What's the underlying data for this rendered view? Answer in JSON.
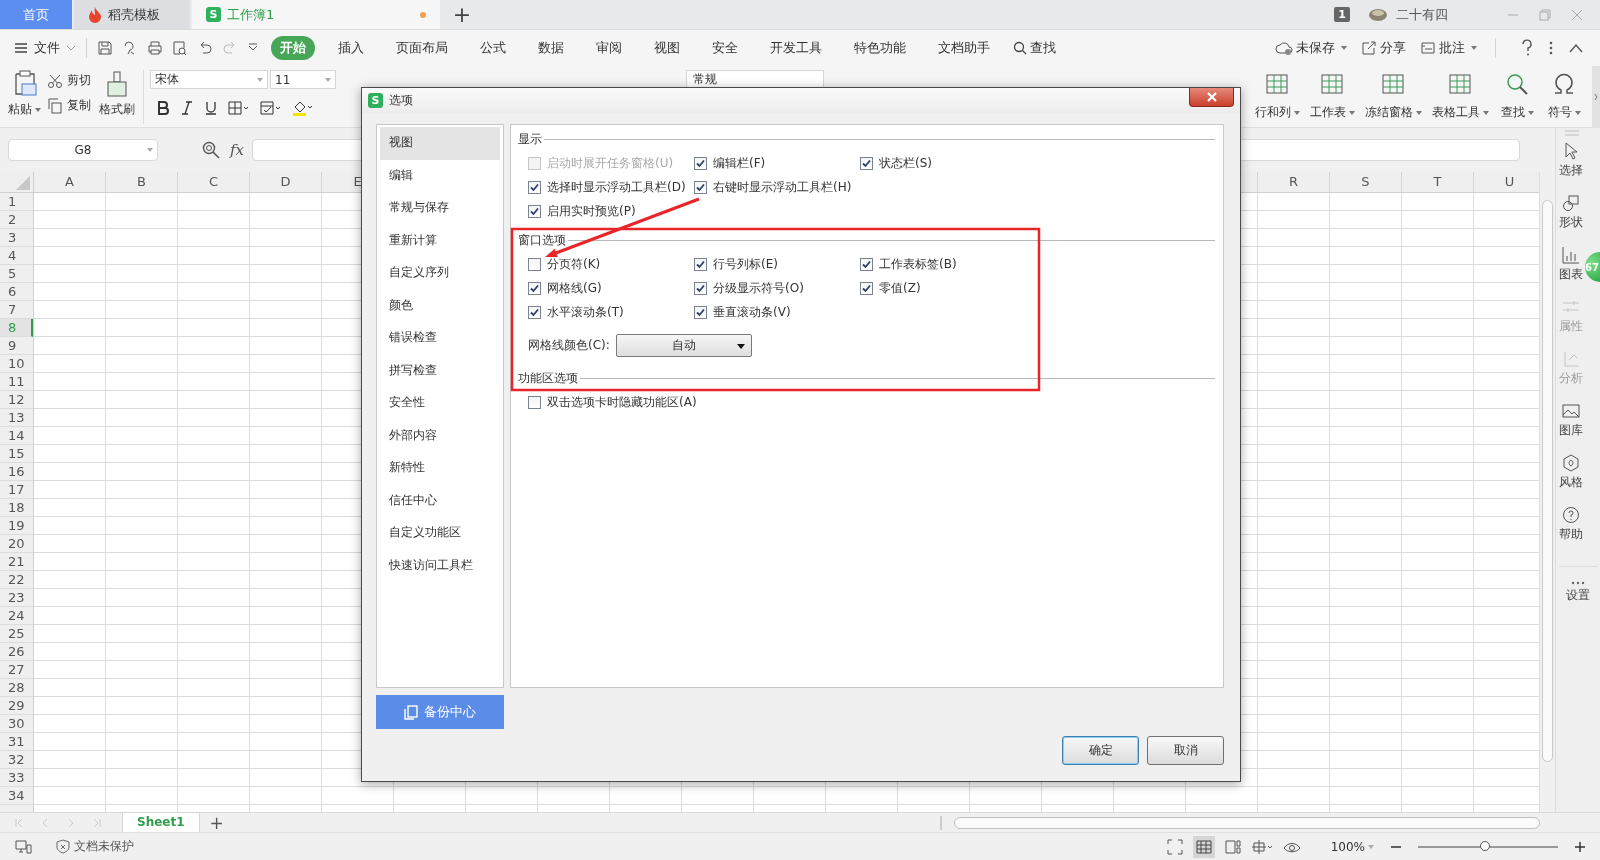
{
  "tabs": [
    {
      "label": "首页",
      "kind": "home",
      "selected": false
    },
    {
      "label": "稻壳模板",
      "kind": "docer",
      "selected": false
    },
    {
      "label": "工作簿1",
      "kind": "sheet",
      "logo": "S",
      "selected": true,
      "modified": true
    }
  ],
  "new_tab": "+",
  "account": {
    "badge": "1",
    "user": "二十有四"
  },
  "menu": {
    "file": "文件",
    "tabs": [
      {
        "label": "开始",
        "selected": true
      },
      {
        "label": "插入",
        "selected": false
      },
      {
        "label": "页面布局",
        "selected": false
      },
      {
        "label": "公式",
        "selected": false
      },
      {
        "label": "数据",
        "selected": false
      },
      {
        "label": "审阅",
        "selected": false
      },
      {
        "label": "视图",
        "selected": false
      },
      {
        "label": "安全",
        "selected": false
      },
      {
        "label": "开发工具",
        "selected": false
      },
      {
        "label": "特色功能",
        "selected": false
      },
      {
        "label": "文档助手",
        "selected": false
      }
    ],
    "search": "查找",
    "actions": [
      "未保存",
      "分享",
      "批注"
    ]
  },
  "ribbon": {
    "paste": "粘贴",
    "cut": "剪切",
    "copy": "复制",
    "format_painter": "格式刷",
    "font": "宋体",
    "size": "11",
    "number_format": "常规",
    "tools": [
      "行和列",
      "工作表",
      "冻结窗格",
      "表格工具",
      "查找",
      "符号"
    ]
  },
  "formula_bar": {
    "name_box": "G8",
    "fx": "fx"
  },
  "sheet": {
    "columns_left": [
      "A",
      "B",
      "C",
      "D",
      "E"
    ],
    "columns_right": [
      "R",
      "S",
      "T",
      "U"
    ],
    "rows": [
      {
        "label": "1",
        "selected": false
      },
      {
        "label": "2",
        "selected": false
      },
      {
        "label": "3",
        "selected": false
      },
      {
        "label": "4",
        "selected": false
      },
      {
        "label": "5",
        "selected": false
      },
      {
        "label": "6",
        "selected": false
      },
      {
        "label": "7",
        "selected": false
      },
      {
        "label": "8",
        "selected": true
      },
      {
        "label": "9",
        "selected": false
      },
      {
        "label": "10",
        "selected": false
      },
      {
        "label": "11",
        "selected": false
      },
      {
        "label": "12",
        "selected": false
      },
      {
        "label": "13",
        "selected": false
      },
      {
        "label": "14",
        "selected": false
      },
      {
        "label": "15",
        "selected": false
      },
      {
        "label": "16",
        "selected": false
      },
      {
        "label": "17",
        "selected": false
      },
      {
        "label": "18",
        "selected": false
      },
      {
        "label": "19",
        "selected": false
      },
      {
        "label": "20",
        "selected": false
      },
      {
        "label": "21",
        "selected": false
      },
      {
        "label": "22",
        "selected": false
      },
      {
        "label": "23",
        "selected": false
      },
      {
        "label": "24",
        "selected": false
      },
      {
        "label": "25",
        "selected": false
      },
      {
        "label": "26",
        "selected": false
      },
      {
        "label": "27",
        "selected": false
      },
      {
        "label": "28",
        "selected": false
      },
      {
        "label": "29",
        "selected": false
      },
      {
        "label": "30",
        "selected": false
      },
      {
        "label": "31",
        "selected": false
      },
      {
        "label": "32",
        "selected": false
      },
      {
        "label": "33",
        "selected": false
      },
      {
        "label": "34",
        "selected": false
      }
    ]
  },
  "sheet_tabs": [
    {
      "label": "Sheet1",
      "selected": true
    }
  ],
  "add_sheet": "+",
  "side_panel": [
    {
      "label": "选择",
      "disabled": false
    },
    {
      "label": "形状",
      "disabled": false
    },
    {
      "label": "图表",
      "disabled": false
    },
    {
      "label": "属性",
      "disabled": true
    },
    {
      "label": "分析",
      "disabled": true
    },
    {
      "label": "图库",
      "disabled": false
    },
    {
      "label": "风格",
      "disabled": false
    },
    {
      "label": "帮助",
      "disabled": false
    },
    {
      "label": "设置",
      "disabled": false
    }
  ],
  "notification_badge": "67",
  "status_bar": {
    "protection": "文档未保护",
    "zoom": "100%",
    "zoom_slider": {
      "level": 0.48
    }
  },
  "dialog": {
    "title": "选项",
    "logo": "S",
    "nav": [
      {
        "label": "视图",
        "selected": true
      },
      {
        "label": "编辑",
        "selected": false
      },
      {
        "label": "常规与保存",
        "selected": false
      },
      {
        "label": "重新计算",
        "selected": false
      },
      {
        "label": "自定义序列",
        "selected": false
      },
      {
        "label": "颜色",
        "selected": false
      },
      {
        "label": "错误检查",
        "selected": false
      },
      {
        "label": "拼写检查",
        "selected": false
      },
      {
        "label": "安全性",
        "selected": false
      },
      {
        "label": "外部内容",
        "selected": false
      },
      {
        "label": "新特性",
        "selected": false
      },
      {
        "label": "信任中心",
        "selected": false
      },
      {
        "label": "自定义功能区",
        "selected": false
      },
      {
        "label": "快速访问工具栏",
        "selected": false
      }
    ],
    "backup": "备份中心",
    "sections": [
      {
        "title": "显示",
        "rows": [
          [
            {
              "label": "启动时展开任务窗格(U)",
              "checked": false,
              "disabled": true
            },
            {
              "label": "编辑栏(F)",
              "checked": true,
              "disabled": false
            },
            {
              "label": "状态栏(S)",
              "checked": true,
              "disabled": false
            }
          ],
          [
            {
              "label": "选择时显示浮动工具栏(D)",
              "checked": true,
              "disabled": false
            },
            {
              "label": "右键时显示浮动工具栏(H)",
              "checked": true,
              "disabled": false
            }
          ],
          [
            {
              "label": "启用实时预览(P)",
              "checked": true,
              "disabled": false
            }
          ]
        ]
      },
      {
        "title": "窗口选项",
        "rows": [
          [
            {
              "label": "分页符(K)",
              "checked": false,
              "disabled": false
            },
            {
              "label": "行号列标(E)",
              "checked": true,
              "disabled": false
            },
            {
              "label": "工作表标签(B)",
              "checked": true,
              "disabled": false
            }
          ],
          [
            {
              "label": "网格线(G)",
              "checked": true,
              "disabled": false
            },
            {
              "label": "分级显示符号(O)",
              "checked": true,
              "disabled": false
            },
            {
              "label": "零值(Z)",
              "checked": true,
              "disabled": false
            }
          ],
          [
            {
              "label": "水平滚动条(T)",
              "checked": true,
              "disabled": false
            },
            {
              "label": "垂直滚动条(V)",
              "checked": true,
              "disabled": false
            }
          ]
        ],
        "color_select": {
          "label": "网格线颜色(C):",
          "value": "自动"
        }
      },
      {
        "title": "功能区选项",
        "rows": [
          [
            {
              "label": "双击选项卡时隐藏功能区(A)",
              "checked": false,
              "disabled": false
            }
          ]
        ]
      }
    ],
    "buttons": [
      {
        "label": "确定",
        "default": true
      },
      {
        "label": "取消",
        "default": false
      }
    ]
  }
}
